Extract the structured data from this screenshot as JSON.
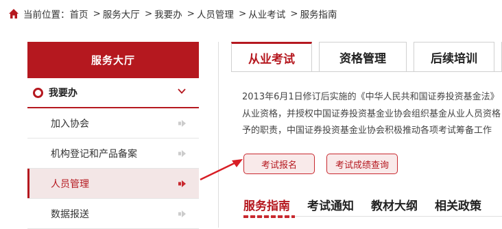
{
  "breadcrumb": {
    "prefix": "当前位置：",
    "items": [
      "首页",
      "服务大厅",
      "我要办",
      "人员管理",
      "从业考试",
      "服务指南"
    ],
    "separator": ">"
  },
  "sidebar": {
    "header": "服务大厅",
    "group_label": "我要办",
    "items": [
      {
        "label": "加入协会"
      },
      {
        "label": "机构登记和产品备案"
      },
      {
        "label": "人员管理"
      },
      {
        "label": "数据报送"
      }
    ]
  },
  "tabs": [
    {
      "label": "从业考试"
    },
    {
      "label": "资格管理"
    },
    {
      "label": "后续培训"
    }
  ],
  "intro": {
    "lines": [
      "2013年6月1日修订后实施的《中华人民共和国证券投资基金法》",
      "从业资格，并授权中国证券投资基金业协会组织基金从业人员资格",
      "予的职责，中国证券投资基金业协会积极推动各项考试筹备工作"
    ]
  },
  "actions": {
    "exam_signup": "考试报名",
    "score_query": "考试成绩查询"
  },
  "subnav": [
    "服务指南",
    "考试通知",
    "教材大纲",
    "相关政策"
  ],
  "colors": {
    "brand_red": "#b5181f",
    "active_bg": "#f3e6e6",
    "button_bg": "#f9eaea"
  }
}
